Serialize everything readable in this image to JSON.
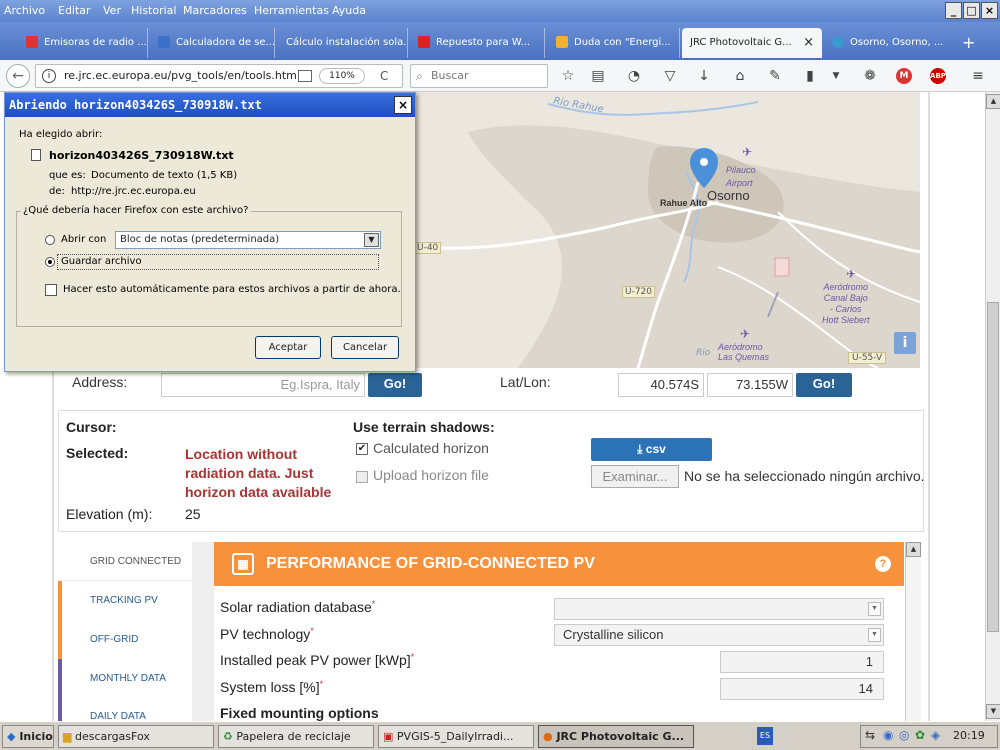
{
  "menu": {
    "items": [
      "Archivo",
      "Editar",
      "Ver",
      "Historial",
      "Marcadores",
      "Herramientas",
      "Ayuda"
    ]
  },
  "window_controls": {
    "minimize": "_",
    "maximize": "□",
    "close": "×"
  },
  "tabs": [
    {
      "label": "Emisoras de radio ...",
      "icon_color": "#d33"
    },
    {
      "label": "Calculadora de se...",
      "icon_color": "#3a70c8"
    },
    {
      "label": "Cálculo instalación sola...",
      "icon_color": ""
    },
    {
      "label": "Repuesto para W...",
      "icon_color": "#d22"
    },
    {
      "label": "Duda con \"Energi...",
      "icon_color": "#f0b030"
    },
    {
      "label": "JRC Photovoltaic G...",
      "icon_color": "",
      "active": true,
      "close": "×"
    },
    {
      "label": "Osorno, Osorno, ...",
      "icon_color": "#3a9ad0"
    }
  ],
  "new_tab": "+",
  "nav": {
    "url": "re.jrc.ec.europa.eu/pvg_tools/en/tools.htm",
    "zoom": "110%",
    "search_placeholder": "Buscar",
    "back_icon": "←",
    "reload_icon": "C",
    "info_icon": "i",
    "badges": {
      "m": "M",
      "abp": "ABP"
    }
  },
  "map": {
    "labels": {
      "river": "Rio Rahue",
      "rahue_alto": "Rahue Alto",
      "osorno": "Osorno",
      "pilauco": "Pilauco",
      "airport": "Airport",
      "road_u40": "U-40",
      "road_u720": "U-720",
      "aerodromo_canal": "Aeródromo\nCanal Bajo\n- Carlos\nHott Siebert",
      "aerodromo_quemas": "Aeródromo\nLas Quemas",
      "rio_small": "Rio",
      "road_u55": "U-55-V",
      "info": "i"
    }
  },
  "address_row": {
    "address_label": "Address:",
    "address_placeholder": "Eg.Ispra, Italy",
    "go_label": "Go!",
    "latlon_label": "Lat/Lon:",
    "lat": "40.574S",
    "lon": "73.155W",
    "go2_label": "Go!"
  },
  "info_panel": {
    "cursor_label": "Cursor:",
    "selected_label": "Selected:",
    "selected_value_lines": [
      "Location without",
      "radiation data. Just",
      "horizon data available"
    ],
    "elevation_label": "Elevation (m):",
    "elevation_value": "25",
    "terrain_title": "Use terrain shadows:",
    "calc_horizon": "Calculated horizon",
    "calc_checked": "✔",
    "upload_horizon": "Upload horizon file",
    "csv_label": "⤓ csv",
    "browse_label": "Examinar...",
    "no_file": "No se ha seleccionado ningún archivo."
  },
  "side_tabs": [
    {
      "label": "GRID CONNECTED",
      "color": "#fff"
    },
    {
      "label": "TRACKING PV",
      "color": "#f7913c"
    },
    {
      "label": "OFF-GRID",
      "color": "#f7913c"
    },
    {
      "label": "MONTHLY DATA",
      "color": "#6a5aa8"
    },
    {
      "label": "DAILY DATA",
      "color": "#6a5aa8"
    }
  ],
  "performance": {
    "title": "PERFORMANCE OF GRID-CONNECTED PV",
    "help": "?",
    "rows": {
      "solar_db_label": "Solar radiation database",
      "solar_db_value": "",
      "pv_tech_label": "PV technology",
      "pv_tech_value": "Crystalline silicon",
      "peak_power_label": "Installed peak PV power [kWp]",
      "peak_power_value": "1",
      "system_loss_label": "System loss [%]",
      "system_loss_value": "14",
      "fixed_mounting": "Fixed mounting options"
    },
    "star": "*"
  },
  "dialog": {
    "title": "Abriendo horizon403426S_730918W.txt",
    "close": "×",
    "chosen": "Ha elegido abrir:",
    "filename": "horizon403426S_730918W.txt",
    "type_label": "que es:",
    "type_value": "Documento de texto (1,5 KB)",
    "from_label": "de:",
    "from_value": "http://re.jrc.ec.europa.eu",
    "question": "¿Qué debería hacer Firefox con este archivo?",
    "open_with": "Abrir con",
    "open_with_value": "Bloc de notas (predeterminada)",
    "save_file": "Guardar archivo",
    "auto": "Hacer esto automáticamente para estos archivos a partir de ahora.",
    "accept": "Aceptar",
    "cancel": "Cancelar"
  },
  "taskbar": {
    "start": "Inicio",
    "items": [
      {
        "label": "descargasFox"
      },
      {
        "label": "Papelera de reciclaje"
      },
      {
        "label": "PVGIS-5_DailyIrradi..."
      },
      {
        "label": "JRC Photovoltaic G...",
        "active": true
      }
    ],
    "lang": "ES",
    "clock": "20:19"
  },
  "scroll_arrows": {
    "up": "▲",
    "down": "▼"
  }
}
